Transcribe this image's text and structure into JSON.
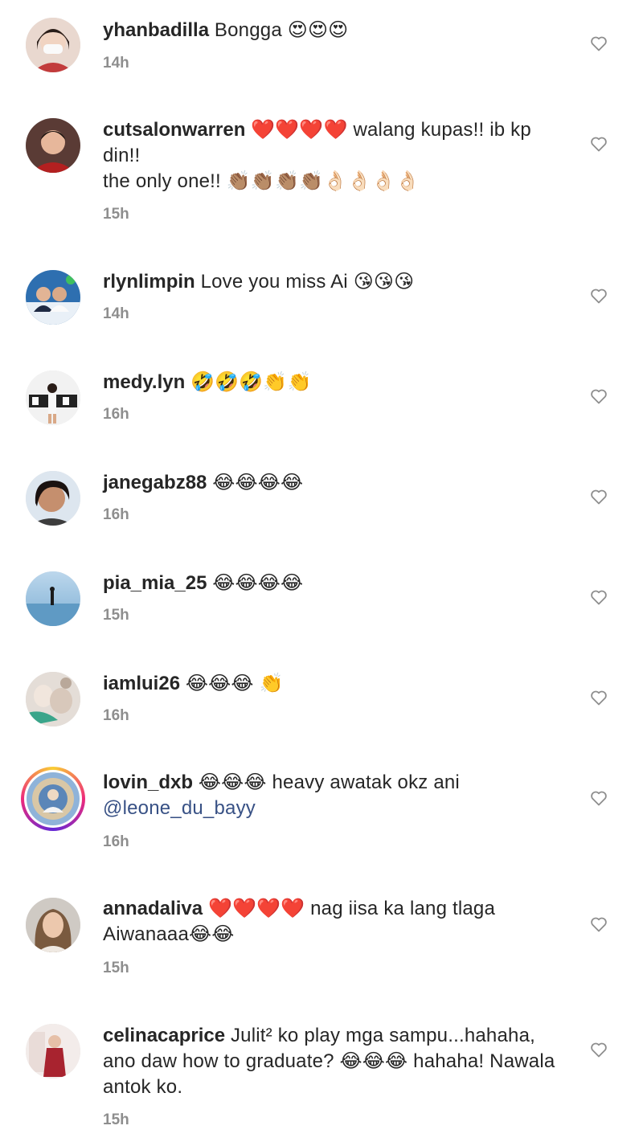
{
  "comments": [
    {
      "username": "yhanbadilla",
      "text": "Bongga 😍😍😍",
      "time": "14h"
    },
    {
      "username": "cutsalonwarren",
      "text": "❤️❤️❤️❤️ walang kupas!! ib kp din!!\nthe only one!! 👏🏽👏🏽👏🏽👏🏽👌🏻👌🏻👌🏻👌🏻",
      "time": "15h"
    },
    {
      "username": "rlynlimpin",
      "text": "Love you miss Ai 😘😘😘",
      "time": "14h"
    },
    {
      "username": "medy.lyn",
      "text": "🤣🤣🤣👏👏",
      "time": "16h"
    },
    {
      "username": "janegabz88",
      "text": "😂😂😂😂",
      "time": "16h"
    },
    {
      "username": "pia_mia_25",
      "text": "😂😂😂😂",
      "time": "15h"
    },
    {
      "username": "iamlui26",
      "text": "😂😂😂 👏",
      "time": "16h"
    },
    {
      "username": "lovin_dxb",
      "text": "😂😂😂 heavy awatak okz ani",
      "mention": "@leone_du_bayy",
      "time": "16h"
    },
    {
      "username": "annadaliva",
      "text": "❤️❤️❤️❤️ nag iisa ka lang tlaga Aiwanaaa😂😂",
      "time": "15h"
    },
    {
      "username": "celinacaprice",
      "text": "Julit² ko play mga sampu...hahaha, ano daw how to graduate? 😂😂😂 hahaha! Nawala antok ko.",
      "time": "15h"
    }
  ],
  "icons": {
    "like": "heart-outline-icon",
    "avatar": "profile-avatar-icon"
  },
  "colors": {
    "text": "#262626",
    "timestamp": "#8e8e8e",
    "mention": "#385185"
  }
}
